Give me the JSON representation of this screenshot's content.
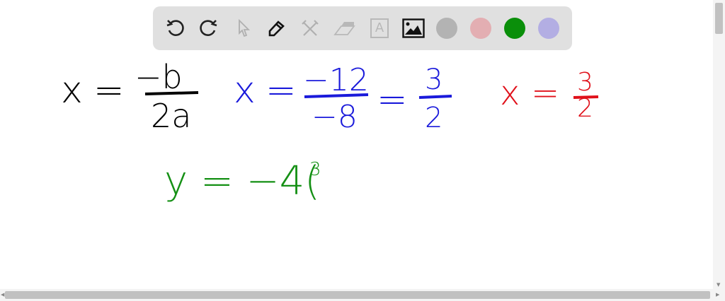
{
  "toolbar": {
    "tools": [
      {
        "name": "undo-icon",
        "enabled": true
      },
      {
        "name": "redo-icon",
        "enabled": true
      },
      {
        "name": "select-pointer-icon",
        "enabled": false
      },
      {
        "name": "pen-icon",
        "enabled": true
      },
      {
        "name": "tools-icon",
        "enabled": false
      },
      {
        "name": "eraser-icon",
        "enabled": false
      },
      {
        "name": "text-icon",
        "enabled": false
      },
      {
        "name": "image-icon",
        "enabled": true
      }
    ],
    "text_tool_glyph": "A",
    "colors": [
      "#b3b3b3",
      "#e3aeb2",
      "#0a8f0a",
      "#b3aee3"
    ]
  },
  "board": {
    "line1_black": {
      "lhs": "x",
      "eq": "=",
      "num": "−b",
      "den": "2a",
      "color": "#000000"
    },
    "line1_blue": {
      "lhs": "x",
      "eq": "=",
      "num": "−12",
      "den": "−8",
      "eq2": "=",
      "num2": "3",
      "den2": "2",
      "color": "#1a1adb"
    },
    "line1_red": {
      "lhs": "x",
      "eq": "=",
      "num": "3",
      "den": "2",
      "color": "#e0101a"
    },
    "line2_green": {
      "text": "y = −4(",
      "sup": "3",
      "color": "#159015"
    }
  }
}
